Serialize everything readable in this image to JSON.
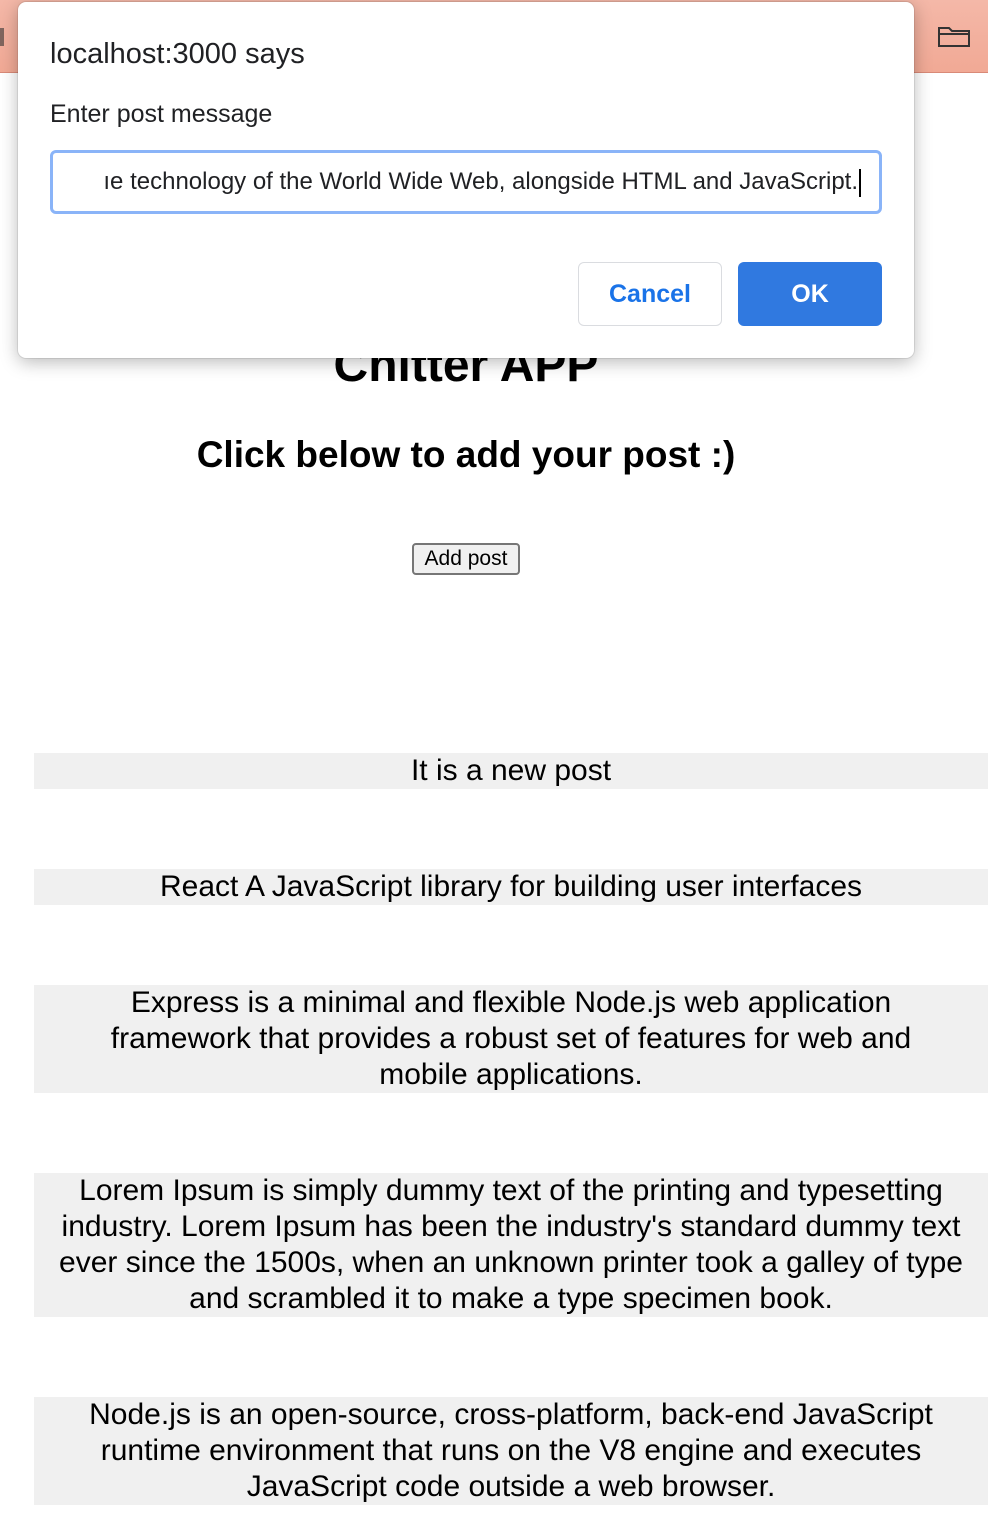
{
  "app": {
    "title": "Chitter APP",
    "subtitle": "Click below to add your post :)",
    "add_post_label": "Add post"
  },
  "posts": [
    "It is a new post",
    "React A JavaScript library for building user interfaces",
    "Express is a minimal and flexible Node.js web application framework that provides a robust set of features for web and mobile applications.",
    "Lorem Ipsum is simply dummy text of the printing and typesetting industry. Lorem Ipsum has been the industry's standard dummy text ever since the 1500s, when an unknown printer took a galley of type and scrambled it to make a type specimen book.",
    "Node.js is an open-source, cross-platform, back-end JavaScript runtime environment that runs on the V8 engine and executes JavaScript code outside a web browser."
  ],
  "dialog": {
    "title": "localhost:3000 says",
    "prompt": "Enter post message",
    "input_value": "ıe technology of the World Wide Web, alongside HTML and JavaScript.",
    "cancel_label": "Cancel",
    "ok_label": "OK"
  },
  "colors": {
    "primary": "#3079e0",
    "link": "#1a73e8",
    "post_background": "#f0f0f0",
    "browser_strip": "#f1a995"
  },
  "icons": {
    "toolbar_right": "folder-icon"
  }
}
